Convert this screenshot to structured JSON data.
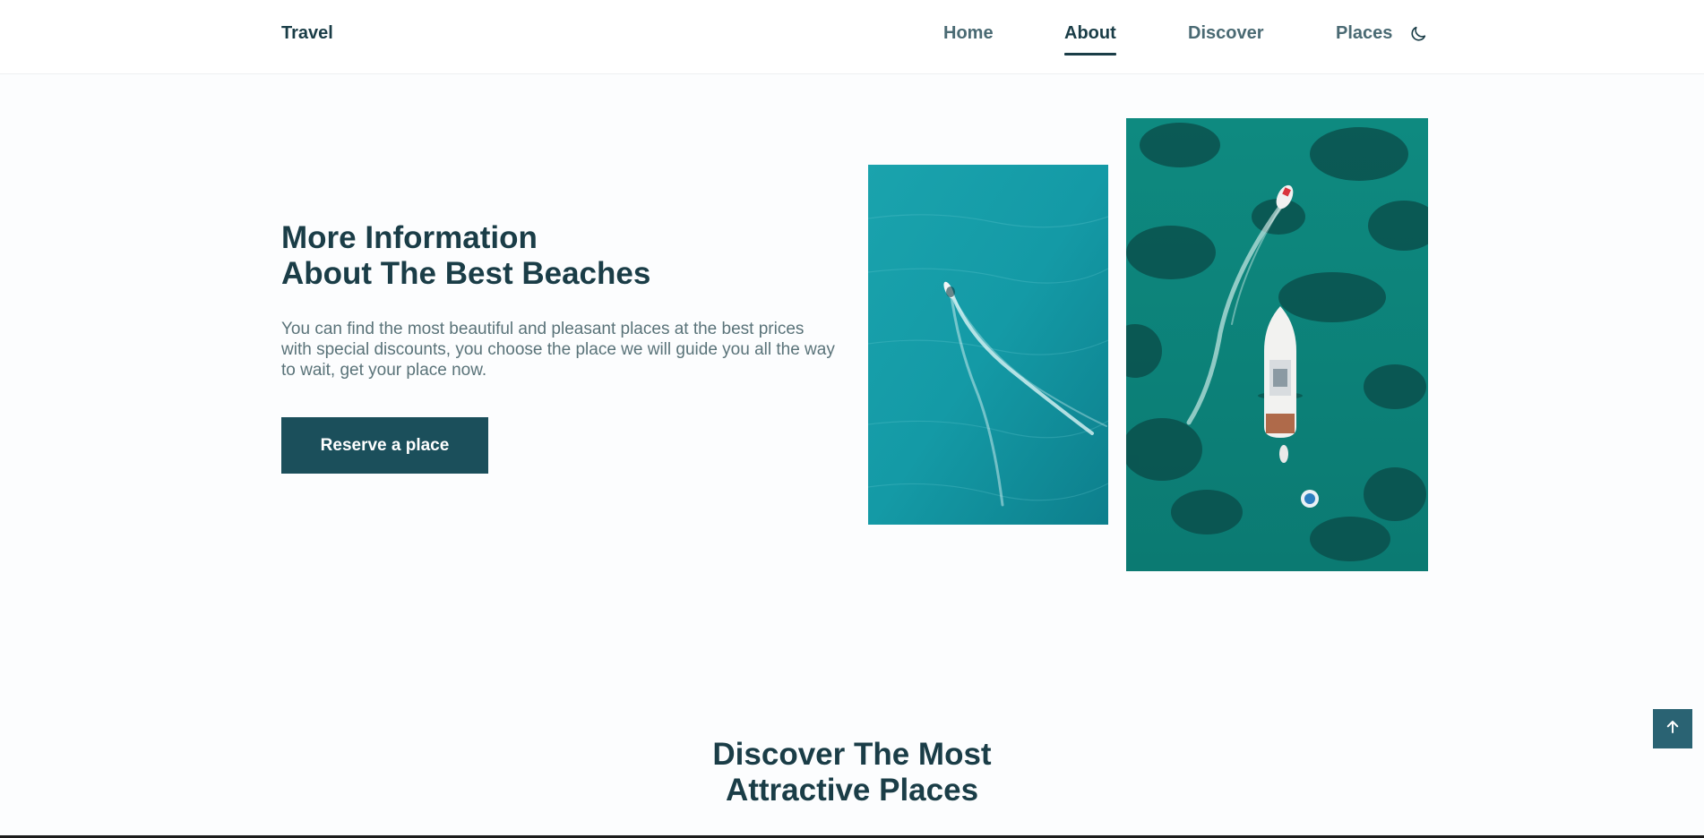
{
  "header": {
    "logo": "Travel",
    "nav": [
      {
        "label": "Home",
        "active": false
      },
      {
        "label": "About",
        "active": true
      },
      {
        "label": "Discover",
        "active": false
      },
      {
        "label": "Places",
        "active": false
      }
    ],
    "theme_icon": "moon-icon"
  },
  "about": {
    "title_line1": "More Information",
    "title_line2": "About The Best Beaches",
    "description": "You can find the most beautiful and pleasant places at the best prices with special discounts, you choose the place we will guide you all the way to wait, get your place now.",
    "button_label": "Reserve a place",
    "images": [
      "aerial-boat-turquoise-photo",
      "aerial-yacht-green-sea-photo"
    ]
  },
  "discover": {
    "title_line1": "Discover The Most",
    "title_line2": "Attractive Places"
  },
  "scroll_up_icon": "arrow-up-icon",
  "colors": {
    "primary": "#1a3d47",
    "button": "#1b4f5b",
    "scroll_button": "#2a6373",
    "text_muted": "#5a7379"
  }
}
